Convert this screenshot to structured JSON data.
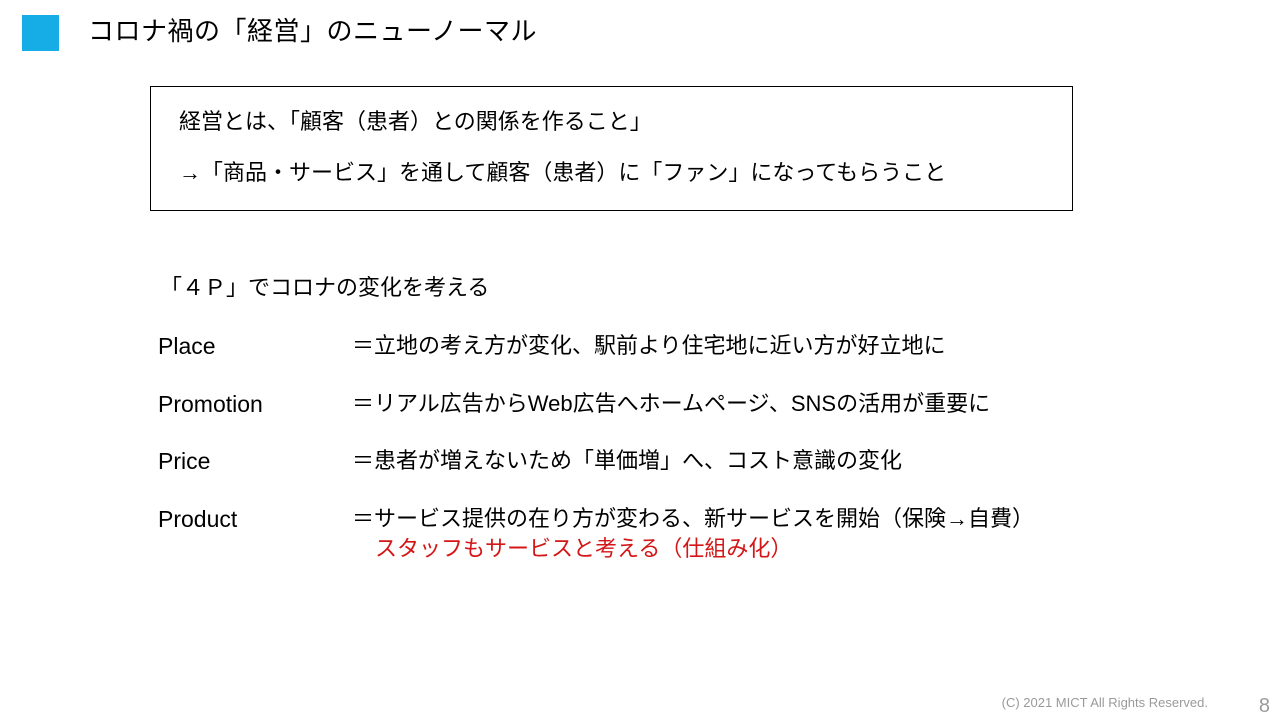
{
  "slide": {
    "title": "コロナ禍の「経営」のニューノーマル",
    "bullet_color": "#16ace6",
    "accent_red": "#d41616"
  },
  "definition_box": {
    "line_1": "経営とは、「顧客（患者）との関係を作ること」",
    "line_2": "→「商品・サービス」を通して顧客（患者）に「ファン」になってもらうこと"
  },
  "four_p": {
    "heading": "「４Ｐ」でコロナの変化を考える",
    "rows": [
      {
        "label": "Place",
        "value": "＝立地の考え方が変化、駅前より住宅地に近い方が好立地に"
      },
      {
        "label": "Promotion",
        "value": "＝リアル広告からWeb広告へホームページ、SNSの活用が重要に"
      },
      {
        "label": "Price",
        "value": "＝患者が増えないため「単価増」へ、コスト意識の変化"
      },
      {
        "label": "Product",
        "value": "＝サービス提供の在り方が変わる、新サービスを開始（保険→自費）"
      }
    ],
    "subnote": "スタッフもサービスと考える（仕組み化）"
  },
  "footer": {
    "copyright": "(C) 2021 MICT All Rights Reserved.",
    "page_number": "8"
  }
}
